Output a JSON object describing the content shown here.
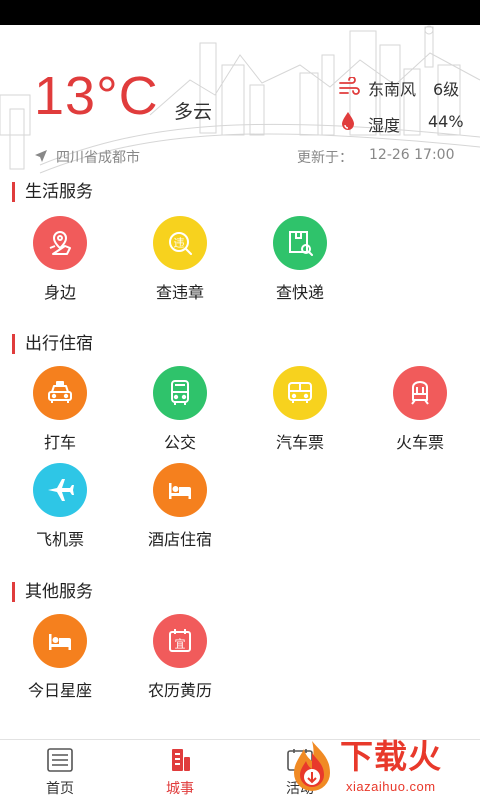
{
  "weather": {
    "temperature": "13°C",
    "condition": "多云",
    "wind_direction": "东南风",
    "wind_level": "6级",
    "humidity_label": "湿度",
    "humidity_value": "44%",
    "location": "四川省成都市",
    "updated_label": "更新于：",
    "updated_time": "12-26 17:00"
  },
  "sections": {
    "life": {
      "title": "生活服务",
      "items": [
        {
          "label": "身边",
          "icon": "map-pin-icon",
          "color": "#f15b5b"
        },
        {
          "label": "查违章",
          "icon": "violation-icon",
          "color": "#f7d21e"
        },
        {
          "label": "查快递",
          "icon": "package-search-icon",
          "color": "#2fc36b"
        }
      ]
    },
    "travel": {
      "title": "出行住宿",
      "items": [
        {
          "label": "打车",
          "icon": "taxi-icon",
          "color": "#f5801e"
        },
        {
          "label": "公交",
          "icon": "bus-icon",
          "color": "#2fc36b"
        },
        {
          "label": "汽车票",
          "icon": "coach-icon",
          "color": "#f7d21e"
        },
        {
          "label": "火车票",
          "icon": "train-icon",
          "color": "#f15b5b"
        },
        {
          "label": "飞机票",
          "icon": "airplane-icon",
          "color": "#2ec6e6"
        },
        {
          "label": "酒店住宿",
          "icon": "hotel-bed-icon",
          "color": "#f5801e"
        }
      ]
    },
    "other": {
      "title": "其他服务",
      "items": [
        {
          "label": "今日星座",
          "icon": "constellation-bed-icon",
          "color": "#f5801e"
        },
        {
          "label": "农历黄历",
          "icon": "calendar-icon",
          "color": "#f15b5b",
          "glyph": "宜"
        }
      ]
    }
  },
  "tabs": [
    {
      "label": "首页",
      "icon": "home-list-icon",
      "active": false
    },
    {
      "label": "城事",
      "icon": "city-icon",
      "active": true
    },
    {
      "label": "活动",
      "icon": "activity-icon",
      "active": false
    }
  ],
  "watermark": {
    "title": "下载火",
    "subtitle": "xiazaihuo.com"
  },
  "colors": {
    "accent": "#e03c3c",
    "watermark": "#e8392b"
  }
}
